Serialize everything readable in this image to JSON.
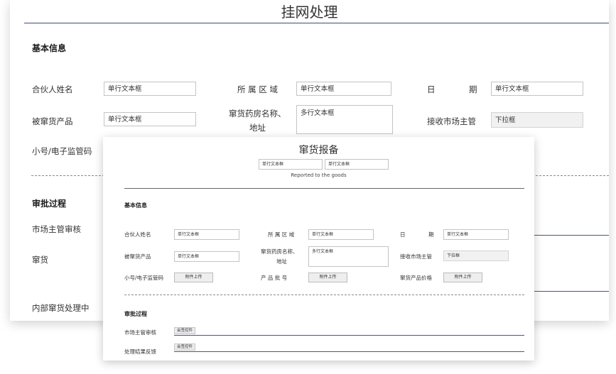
{
  "back": {
    "title": "挂网处理",
    "basic_section": "基本信息",
    "fields": {
      "partner_name": {
        "label": "合伙人姓名",
        "value": "单行文本框"
      },
      "region": {
        "label": "所 属 区 域",
        "value": "单行文本框"
      },
      "date_label_a": "日",
      "date_label_b": "期",
      "date_value": "单行文本框",
      "product": {
        "label": "被窜货产品",
        "value": "单行文本框"
      },
      "pharmacy_label_1": "窜货药房名称、",
      "pharmacy_label_2": "地址",
      "pharmacy_value": "多行文本框",
      "manager": {
        "label": "接收市场主管",
        "value": "下拉框"
      },
      "code": {
        "label": "小号/电子监管码"
      }
    },
    "approval_section": "审批过程",
    "approval_rows": [
      "市场主管审核",
      "窜货",
      "内部窜货处理中"
    ]
  },
  "front": {
    "title": "窜货报备",
    "header_input_1": "单行文本框",
    "header_input_2": "单行文本框",
    "subtitle": "Reported to the goods",
    "basic_section": "基本信息",
    "fields": {
      "partner_name": {
        "label": "合伙人姓名",
        "value": "单行文本框"
      },
      "region": {
        "label": "所 属 区 域",
        "value": "单行文本框"
      },
      "date_label_a": "日",
      "date_label_b": "期",
      "date_value": "单行文本框",
      "product": {
        "label": "被窜货产品",
        "value": "单行文本框"
      },
      "pharmacy_label_1": "窜货药房名称、",
      "pharmacy_label_2": "地址",
      "pharmacy_value": "多行文本框",
      "manager": {
        "label": "接收市场主管",
        "value": "下拉框"
      },
      "code": {
        "label": "小号/电子监管码",
        "button": "附件上传"
      },
      "batch": {
        "label": "产 品 批 号",
        "button": "附件上传"
      },
      "price": {
        "label": "窜货产品价格",
        "button": "附件上传"
      }
    },
    "approval_section": "审批过程",
    "approval_rows": [
      {
        "label": "市场主管审核",
        "button": "会签控件"
      },
      {
        "label": "处理结果反馈",
        "button": "会签控件"
      }
    ]
  }
}
